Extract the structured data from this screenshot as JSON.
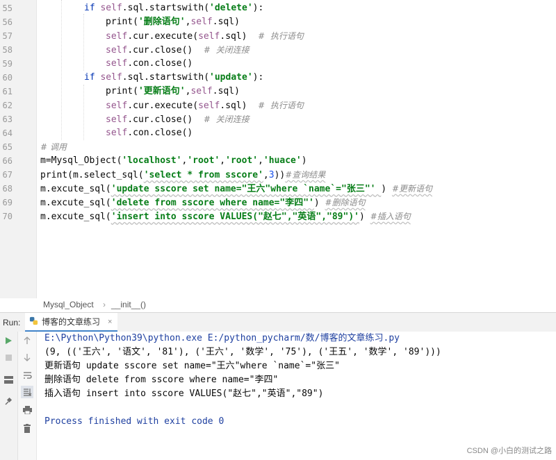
{
  "editor": {
    "line_numbers": [
      "55",
      "56",
      "57",
      "58",
      "59",
      "60",
      "61",
      "62",
      "63",
      "64",
      "65",
      "66",
      "67",
      "68",
      "69",
      "70"
    ]
  },
  "tokens": {
    "if": "if",
    "self": "self",
    "dot_sql_startswith": ".sql.startswith(",
    "delete_q": "'delete'",
    "update_q": "'update'",
    "close_paren_colon": "):",
    "print_open": "print(",
    "del_label_q": "'删除语句'",
    "upd_label_q": "'更新语句'",
    "comma": ",",
    "dot_sql_close": ".sql)",
    "dot_cur_execute": ".cur.execute(",
    "comment_exec": "#  执行语句",
    "dot_cur_close": ".cur.close()",
    "comment_close": "#  关闭连接",
    "dot_con_close": ".con.close()",
    "comment_call": "# 调用",
    "m_assign_open": "m=Mysql_Object(",
    "localhost_q": "'localhost'",
    "root_q": "'root'",
    "huace_q": "'huace'",
    "close_paren": ")",
    "print_m_select": "print(m.select_sql(",
    "select_q": "'select * from sscore'",
    "three": "3",
    "close_two": "))",
    "comment_query": "#查询结果",
    "m_excute_open": "m.excute_sql(",
    "update_stmt_q": "'update sscore set name=\"王六\"where `name`=\"张三\"' ",
    "close_paren_space": ") ",
    "comment_update": "#更新语句",
    "delete_stmt_q": "'delete from sscore where name=\"李四\"'",
    "comment_delete": "#删除语句",
    "insert_stmt_q": "'insert into sscore VALUES(\"赵七\",\"英语\",\"89\")'",
    "comment_insert": "#插入语句"
  },
  "breadcrumb": {
    "class_name": "Mysql_Object",
    "separator": "›",
    "method_name": "__init__()"
  },
  "run": {
    "label": "Run:",
    "tab_title": "博客的文章练习",
    "tab_close": "×"
  },
  "console": {
    "lines": [
      "E:\\Python\\Python39\\python.exe E:/python_pycharm/数/博客的文章练习.py",
      "(9, (('王六', '语文', '81'), ('王六', '数学', '75'), ('王五', '数学', '89')))",
      "更新语句 update sscore set name=\"王六\"where `name`=\"张三\"",
      "删除语句 delete from sscore where name=\"李四\"",
      "插入语句 insert into sscore VALUES(\"赵七\",\"英语\",\"89\")",
      "Process finished with exit code 0"
    ]
  },
  "watermark": "CSDN @小白的测试之路",
  "colors": {
    "keyword": "#0033b3",
    "self": "#94558d",
    "string": "#067d17",
    "comment": "#8c8c8c",
    "number": "#1750eb",
    "console_path": "#1f40a0",
    "run_green": "#59a869",
    "tab_underline": "#4083c9"
  }
}
